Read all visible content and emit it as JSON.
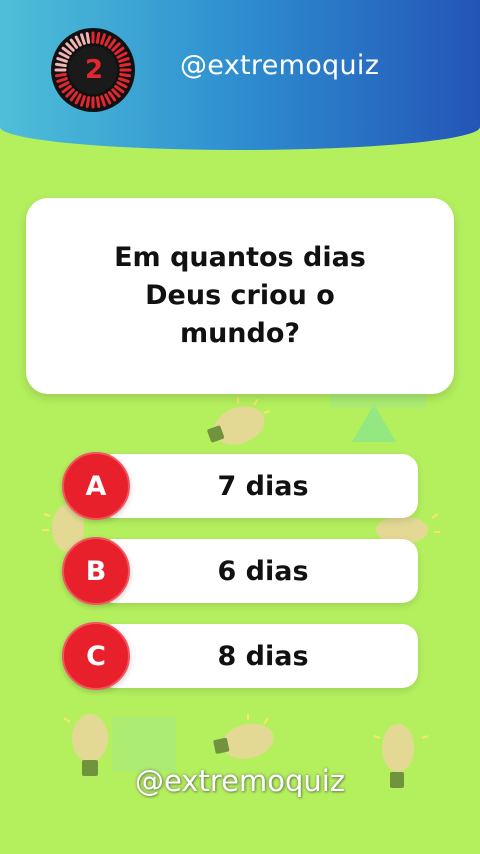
{
  "header": {
    "timer_value": "2",
    "handle": "@extremoquiz"
  },
  "question": {
    "text": "Em quantos dias Deus criou o mundo?"
  },
  "answers": [
    {
      "letter": "A",
      "text": "7 dias"
    },
    {
      "letter": "B",
      "text": "6 dias"
    },
    {
      "letter": "C",
      "text": "8 dias"
    }
  ],
  "footer": {
    "handle": "@extremoquiz"
  },
  "colors": {
    "background": "#b4f05e",
    "header_start": "#4ebfd8",
    "header_end": "#2355b7",
    "badge": "#e8202c",
    "timer_ring": "#e2282e"
  },
  "icons": {
    "timer": "countdown-timer-icon",
    "decor": "lightbulb-icon"
  }
}
